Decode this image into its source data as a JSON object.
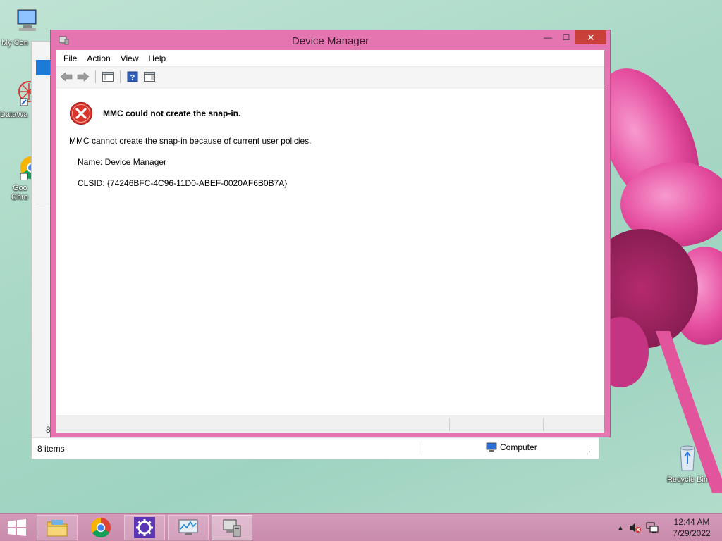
{
  "desktop": {
    "icons": [
      {
        "label": "My Con",
        "label2": ""
      },
      {
        "label": "DataWa",
        "label2": ""
      },
      {
        "label": "Goo",
        "label2": "Chro"
      },
      {
        "label": "Recycle Bin",
        "label2": ""
      }
    ]
  },
  "background_window": {
    "status_items": "8 items",
    "left_number": "8",
    "computer_label": "Computer"
  },
  "window": {
    "title": "Device Manager",
    "controls": {
      "minimize": "—",
      "maximize": "☐",
      "close": "✕"
    },
    "menu": [
      "File",
      "Action",
      "View",
      "Help"
    ],
    "toolbar_icons": [
      "back-icon",
      "forward-icon",
      "console-tree-icon",
      "help-icon",
      "action-pane-icon"
    ],
    "error": {
      "heading": "MMC could not create the snap-in.",
      "message": "MMC cannot create the snap-in because of current user policies.",
      "name_line": "Name: Device Manager",
      "clsid_line": "CLSID: {74246BFC-4C96-11D0-ABEF-0020AF6B0B7A}"
    }
  },
  "taskbar": {
    "buttons": [
      "start-button",
      "file-explorer",
      "chrome",
      "settings",
      "resource-monitor",
      "device-manager"
    ],
    "clock": {
      "time": "12:44 AM",
      "date": "7/29/2022"
    }
  },
  "colors": {
    "window_frame": "#e575b1",
    "close_button": "#c9403b",
    "taskbar": "#d39ab8",
    "error_red": "#d9342b"
  }
}
